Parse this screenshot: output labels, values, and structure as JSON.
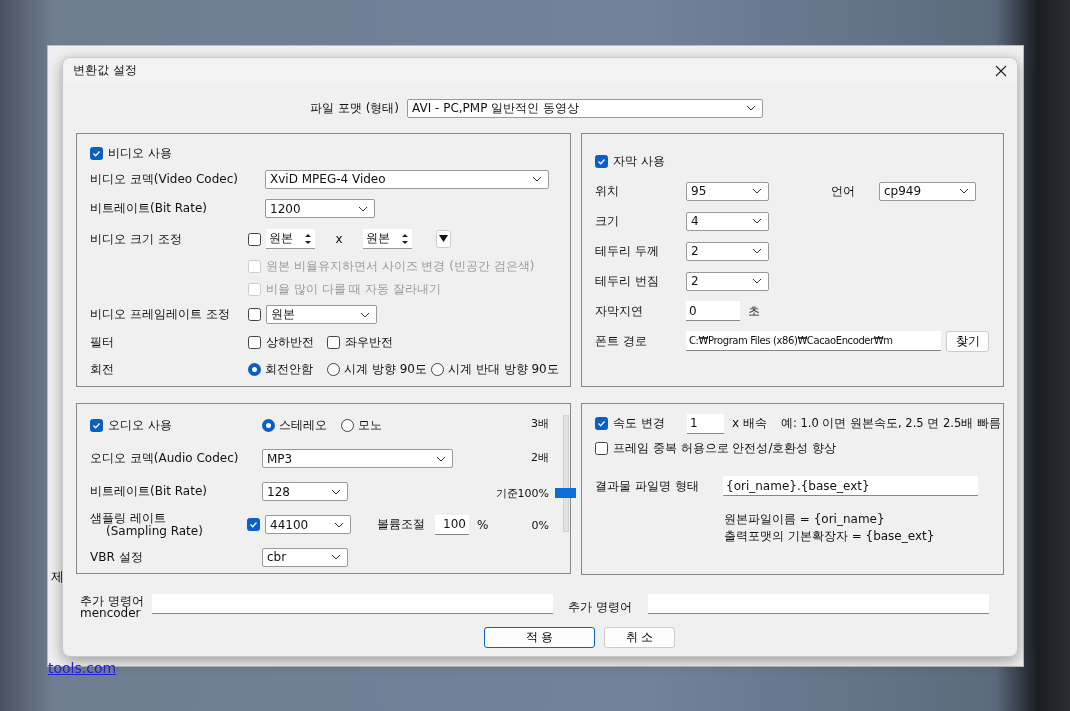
{
  "background_window": {
    "side_text": "제",
    "link": "tools.com"
  },
  "window": {
    "title": "변환값 설정"
  },
  "file_format": {
    "label": "파일 포맷 (형태)",
    "value": "AVI - PC,PMP 일반적인 동영상"
  },
  "video": {
    "enabled": {
      "label": "비디오 사용",
      "checked": true
    },
    "codec": {
      "label": "비디오 코덱(Video Codec)",
      "value": "XviD MPEG-4 Video"
    },
    "bitrate": {
      "label": "비트레이트(Bit Rate)",
      "value": "1200"
    },
    "resize": {
      "label": "비디오 크기 조정",
      "checked": false,
      "width": "원본",
      "separator": "x",
      "height": "원본",
      "options": [
        {
          "label": "원본 비율유지하면서 사이즈 변경 (빈공간 검은색)",
          "checked": false,
          "disabled": true
        },
        {
          "label": "비율 많이 다를 때 자동 잘라내기",
          "checked": false,
          "disabled": true
        }
      ]
    },
    "framerate": {
      "label": "비디오 프레임레이트 조정",
      "checked": false,
      "value": "원본"
    },
    "filter": {
      "label": "필터",
      "options": [
        {
          "label": "상하반전",
          "checked": false
        },
        {
          "label": "좌우반전",
          "checked": false
        }
      ]
    },
    "rotation": {
      "label": "회전",
      "options": [
        {
          "label": "회전안함",
          "selected": true
        },
        {
          "label": "시계 방향 90도",
          "selected": false
        },
        {
          "label": "시계 반대 방향 90도",
          "selected": false
        }
      ]
    }
  },
  "subtitles": {
    "enabled": {
      "label": "자막 사용",
      "checked": true
    },
    "rows": [
      {
        "kind": "select",
        "label": "위치",
        "value": "95",
        "extra_label": "언어",
        "extra_value": "cp949"
      },
      {
        "kind": "select",
        "label": "크기",
        "value": "4"
      },
      {
        "kind": "select",
        "label": "테두리 두께",
        "value": "2"
      },
      {
        "kind": "select",
        "label": "테두리 번짐",
        "value": "2"
      },
      {
        "kind": "input",
        "label": "자막지연",
        "value": "0",
        "unit": "초"
      },
      {
        "kind": "path",
        "label": "폰트 경로",
        "value": "C:₩Program Files (x86)₩CacaoEncoder₩m",
        "button": "찾기"
      }
    ]
  },
  "audio": {
    "enabled": {
      "label": "오디오 사용",
      "checked": true
    },
    "channels": [
      {
        "label": "스테레오",
        "selected": true
      },
      {
        "label": "모노",
        "selected": false
      }
    ],
    "codec": {
      "label": "오디오 코덱(Audio Codec)",
      "value": "MP3"
    },
    "bitrate": {
      "label": "비트레이트(Bit Rate)",
      "value": "128"
    },
    "sampling": {
      "label": "샘플링 레이트",
      "sublabel": "(Sampling Rate)",
      "checked": true,
      "value": "44100"
    },
    "volume": {
      "label": "볼륨조절",
      "value": "100",
      "unit": "%"
    },
    "vbr": {
      "label": "VBR 설정",
      "value": "cbr"
    },
    "volume_slider": {
      "level": 0.33,
      "ticks": [
        "3배",
        "2배",
        "기준100%",
        "0%"
      ]
    }
  },
  "speed": {
    "enabled": {
      "label": "속도 변경",
      "checked": true
    },
    "value": "1",
    "unit": "x 배속",
    "hint": "예: 1.0 이면 원본속도, 2.5 면 2.5배 빠름",
    "frame_dup": {
      "label": "프레임 중복 허용으로 안전성/호환성 향상",
      "checked": false
    },
    "output_name": {
      "label": "결과물 파일명 형태",
      "value": "{ori_name}.{base_ext}",
      "help": [
        "원본파일이름 = {ori_name}",
        "출력포맷의 기본확장자 = {base_ext}"
      ]
    }
  },
  "extra_commands": [
    {
      "label": "추가 명령어",
      "sublabel": "mencoder"
    },
    {
      "label": "추가 명령어"
    }
  ],
  "buttons": [
    {
      "label": "적 용",
      "default": true
    },
    {
      "label": "취 소",
      "default": false
    }
  ]
}
